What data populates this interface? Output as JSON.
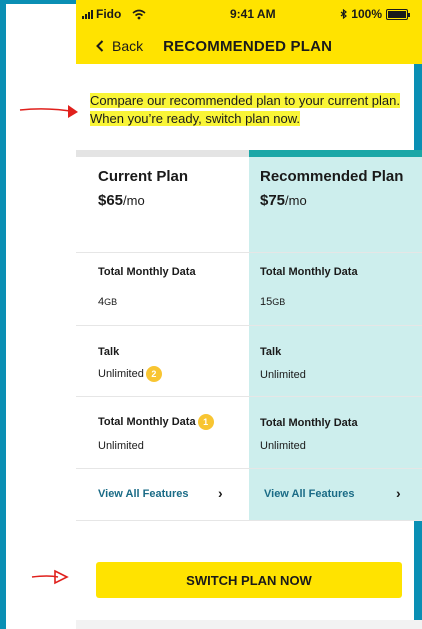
{
  "status_bar": {
    "carrier": "Fido",
    "time": "9:41 AM",
    "battery": "100%",
    "wifi_icon": "wifi-icon",
    "signal_icon": "signal-icon",
    "battery_icon": "battery-icon"
  },
  "nav": {
    "back_label": "Back",
    "title": "RECOMMENDED PLAN"
  },
  "intro": "Compare our recommended plan to your current plan.  When you’re ready, switch plan now.",
  "plans": {
    "current": {
      "name": "Current Plan",
      "price": "$65",
      "price_unit": "/mo",
      "data_label": "Total Monthly Data",
      "data_value_num": "4",
      "data_value_unit": "GB",
      "talk_label": "Talk",
      "talk_value": "Unlimited",
      "talk_badge": "2",
      "extra_label": "Total Monthly Data",
      "extra_badge": "1",
      "extra_value": "Unlimited",
      "features_link": "View All Features"
    },
    "recommended": {
      "name": "Recommended Plan",
      "price": "$75",
      "price_unit": "/mo",
      "data_label": "Total Monthly Data",
      "data_value_num": "15",
      "data_value_unit": "GB",
      "talk_label": "Talk",
      "talk_value": "Unlimited",
      "extra_label": "Total Monthly Data",
      "extra_value": "Unlimited",
      "features_link": "View All Features"
    }
  },
  "cta": {
    "label": "SWITCH PLAN NOW"
  },
  "colors": {
    "brand_yellow": "#ffe300",
    "teal_accent": "#1aa7a7",
    "recommended_bg": "#cdeeed",
    "frame_blue": "#0a8fb4",
    "annotation_red": "#e0201c",
    "badge_orange": "#f8c532"
  }
}
